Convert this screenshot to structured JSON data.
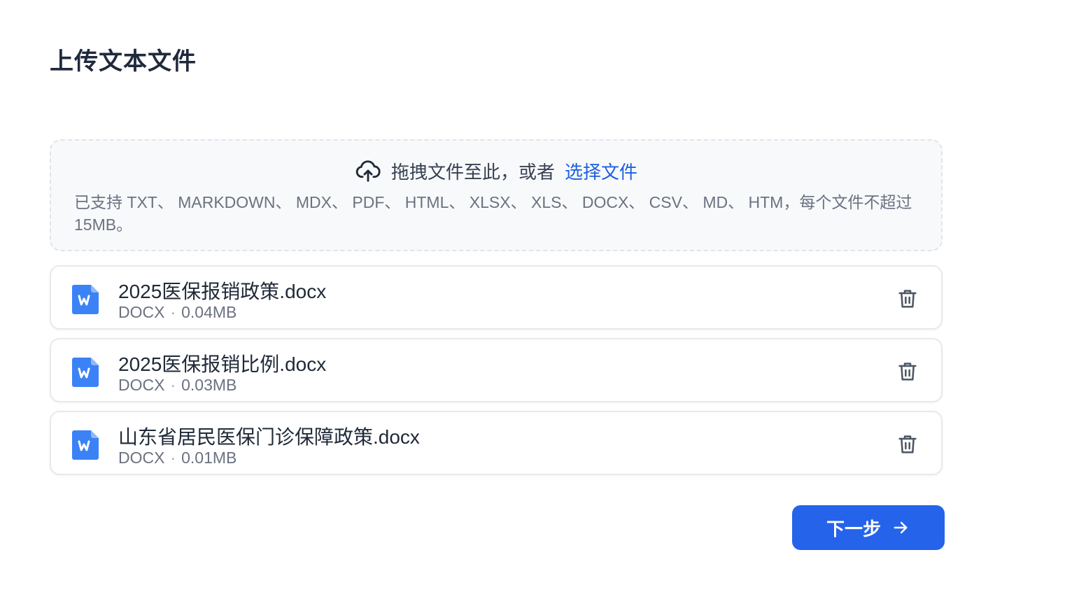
{
  "page": {
    "title": "上传文本文件"
  },
  "dropzone": {
    "icon": "cloud-upload-icon",
    "prompt": "拖拽文件至此，或者",
    "choose_label": "选择文件",
    "hint": "已支持 TXT、 MARKDOWN、 MDX、 PDF、 HTML、 XLSX、 XLS、 DOCX、 CSV、 MD、 HTM，每个文件不超过 15MB。"
  },
  "files": [
    {
      "name": "2025医保报销政策.docx",
      "type": "DOCX",
      "size": "0.04MB",
      "icon": "word-file-icon"
    },
    {
      "name": "2025医保报销比例.docx",
      "type": "DOCX",
      "size": "0.03MB",
      "icon": "word-file-icon"
    },
    {
      "name": "山东省居民医保门诊保障政策.docx",
      "type": "DOCX",
      "size": "0.01MB",
      "icon": "word-file-icon"
    }
  ],
  "meta_separator": "·",
  "actions": {
    "next_label": "下一步",
    "next_icon": "arrow-right-icon"
  },
  "colors": {
    "primary": "#2563eb",
    "link": "#1d5fe0",
    "file_icon": "#3b82f6",
    "dropzone_bg": "#f8f9fb"
  }
}
